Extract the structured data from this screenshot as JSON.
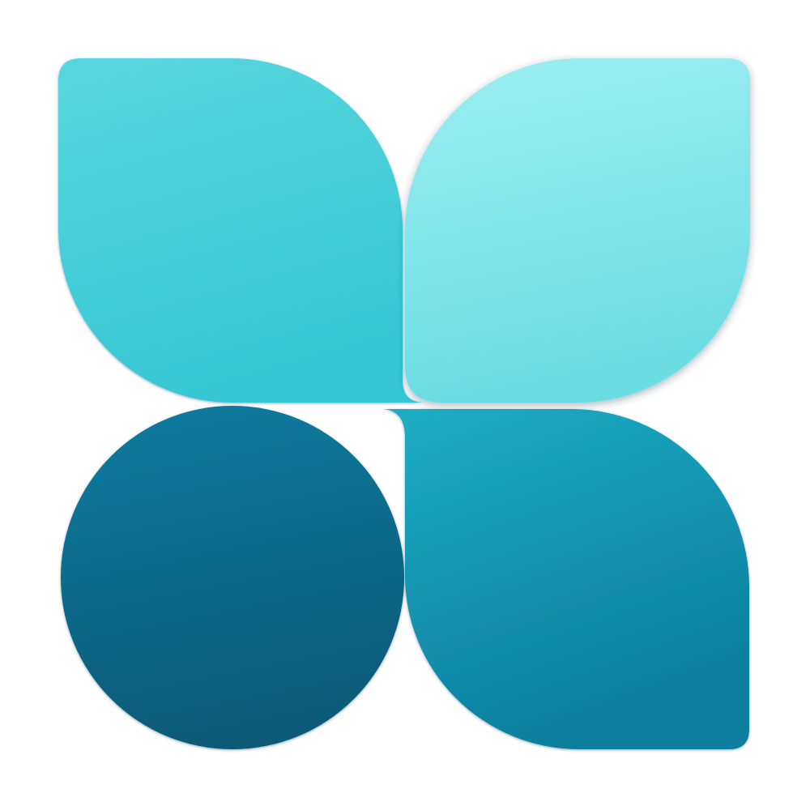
{
  "logo": {
    "icon": "four-petal-logo-icon",
    "colors": {
      "top_left_petal": [
        "#58D6DE",
        "#36C7D4"
      ],
      "top_right_petal": [
        "#9DEFF1",
        "#6ADCE3"
      ],
      "bottom_left_circle": [
        "#0B7CA0",
        "#0B5A78"
      ],
      "bottom_right_petal": [
        "#1EAEC4",
        "#0C7E9E"
      ],
      "background": "#FFFFFF"
    }
  }
}
